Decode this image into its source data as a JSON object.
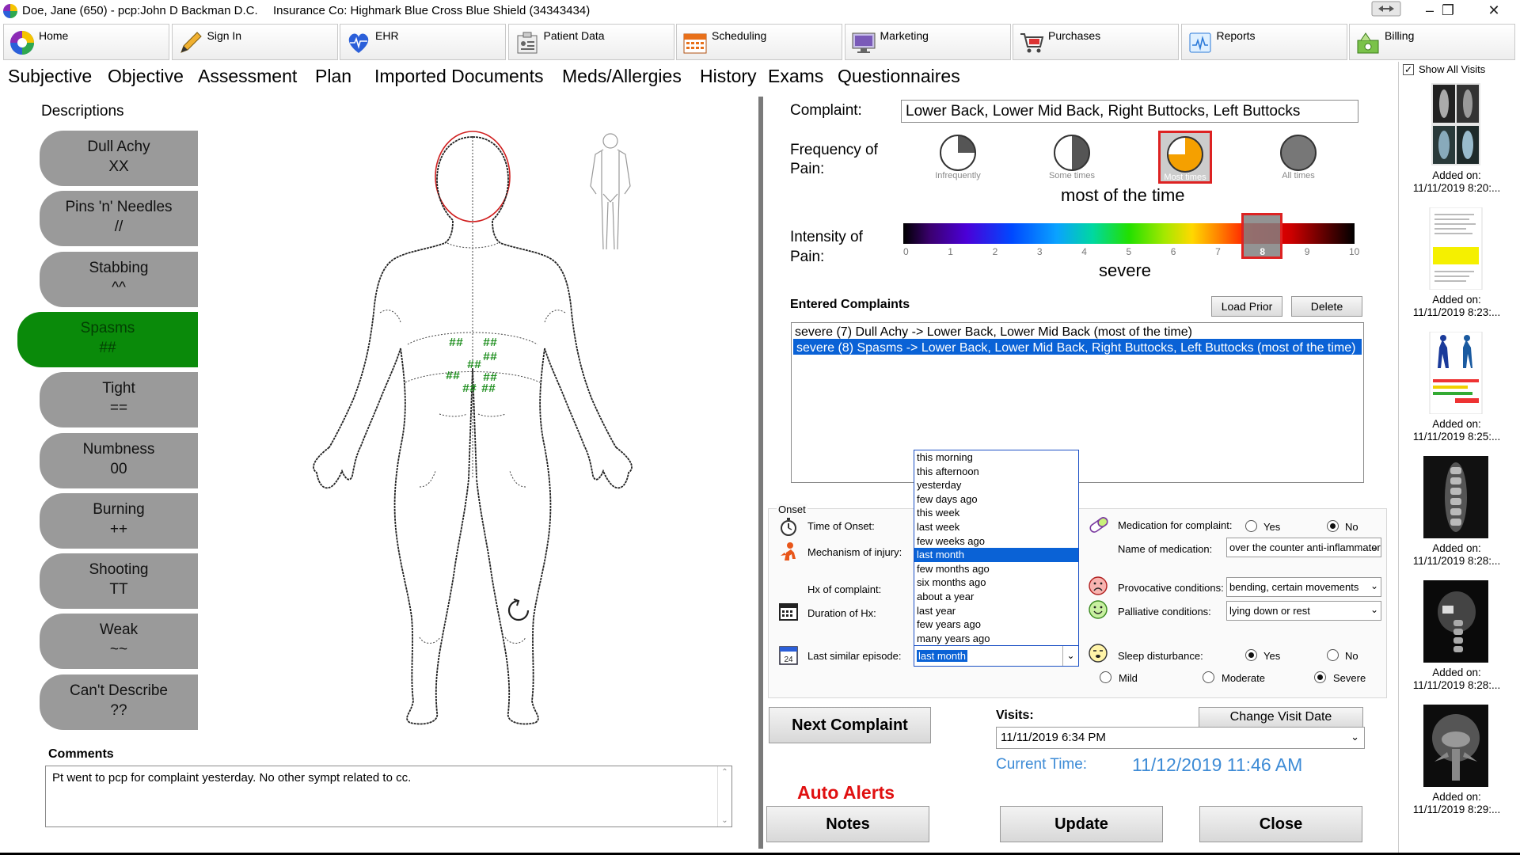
{
  "titlebar": {
    "patient": "Doe, Jane (650) - pcp:John D Backman D.C.",
    "insurance": "Insurance Co: Highmark Blue Cross Blue Shield (34343434)"
  },
  "toolbar": [
    {
      "label": "Home",
      "icon": "home-logo-icon"
    },
    {
      "label": "Sign In",
      "icon": "pencil-icon"
    },
    {
      "label": "EHR",
      "icon": "heart-icon"
    },
    {
      "label": "Patient Data",
      "icon": "patient-data-icon"
    },
    {
      "label": "Scheduling",
      "icon": "calendar-icon"
    },
    {
      "label": "Marketing",
      "icon": "monitor-icon"
    },
    {
      "label": "Purchases",
      "icon": "cart-icon"
    },
    {
      "label": "Reports",
      "icon": "report-icon"
    },
    {
      "label": "Billing",
      "icon": "billing-icon"
    }
  ],
  "tabs": [
    "Subjective",
    "Objective",
    "Assessment",
    "Plan",
    "Imported Documents",
    "Meds/Allergies",
    "History",
    "Exams",
    "Questionnaires"
  ],
  "active_tab": "Subjective",
  "descriptions_title": "Descriptions",
  "descriptions": [
    {
      "name": "Dull Achy",
      "symbol": "XX"
    },
    {
      "name": "Pins 'n' Needles",
      "symbol": "//"
    },
    {
      "name": "Stabbing",
      "symbol": "^^"
    },
    {
      "name": "Spasms",
      "symbol": "##"
    },
    {
      "name": "Tight",
      "symbol": "=="
    },
    {
      "name": "Numbness",
      "symbol": "00"
    },
    {
      "name": "Burning",
      "symbol": "++"
    },
    {
      "name": "Shooting",
      "symbol": "TT"
    },
    {
      "name": "Weak",
      "symbol": "~~"
    },
    {
      "name": "Can't Describe",
      "symbol": "??"
    }
  ],
  "active_description": "Spasms",
  "body_marks": "##",
  "comments": {
    "label": "Comments",
    "text": "Pt went to pcp for complaint yesterday.  No other sympt related to cc."
  },
  "complaint": {
    "label": "Complaint:",
    "value": "Lower Back, Lower Mid Back, Right Buttocks, Left Buttocks"
  },
  "frequency": {
    "label_1": "Frequency of",
    "label_2": "Pain:",
    "options": [
      "Infrequently",
      "Some times",
      "Most times",
      "All times"
    ],
    "selected": "Most times",
    "text": "most of the time"
  },
  "intensity": {
    "label_1": "Intensity of",
    "label_2": "Pain:",
    "ticks": [
      "0",
      "1",
      "2",
      "3",
      "4",
      "5",
      "6",
      "7",
      "8",
      "9",
      "10"
    ],
    "selected": 8,
    "text": "severe"
  },
  "entered": {
    "label": "Entered Complaints",
    "load_prior": "Load Prior",
    "delete": "Delete",
    "items": [
      "severe (7) Dull Achy -> Lower Back, Lower Mid Back (most of the time)",
      "severe (8) Spasms -> Lower Back, Lower Mid Back, Right Buttocks, Left Buttocks (most of the time)"
    ],
    "selected_index": 1
  },
  "onset": {
    "group_label": "Onset",
    "time_of_onset": "Time of Onset:",
    "mechanism": "Mechanism of injury:",
    "hx": "Hx of complaint:",
    "duration": "Duration of Hx:",
    "last_similar": "Last similar episode:",
    "last_similar_value": "last month",
    "dropdown_options": [
      "this morning",
      "this afternoon",
      "yesterday",
      "few days ago",
      "this week",
      "last week",
      "few weeks ago",
      "last month",
      "few months ago",
      "six months ago",
      "about a year",
      "last year",
      "few years ago",
      "many years ago"
    ],
    "dropdown_selected": "last month",
    "calendar_day": "24"
  },
  "medication": {
    "label": "Medication for complaint:",
    "yes": "Yes",
    "no": "No",
    "selected": "No",
    "name_label": "Name of medication:",
    "name_value": "over the counter anti-inflammatory"
  },
  "provocative": {
    "label": "Provocative conditions:",
    "value": "bending, certain movements"
  },
  "palliative": {
    "label": "Palliative conditions:",
    "value": "lying down or rest"
  },
  "sleep": {
    "label": "Sleep disturbance:",
    "yes": "Yes",
    "no": "No",
    "selected": "Yes",
    "mild": "Mild",
    "moderate": "Moderate",
    "severe": "Severe",
    "severity": "Severe"
  },
  "buttons": {
    "next_complaint": "Next Complaint",
    "notes": "Notes",
    "update": "Update",
    "close": "Close",
    "change_visit_date": "Change Visit Date"
  },
  "visits": {
    "label": "Visits:",
    "value": "11/11/2019 6:34 PM"
  },
  "current_time": {
    "label": "Current Time:",
    "value": "11/12/2019  11:46 AM"
  },
  "auto_alerts": "Auto Alerts",
  "thumbnails": {
    "show_all": "Show All Visits",
    "checked": true,
    "items": [
      {
        "caption": "Added on:",
        "date": "11/11/2019 8:20:..."
      },
      {
        "caption": "Added on:",
        "date": "11/11/2019 8:23:..."
      },
      {
        "caption": "Added on:",
        "date": "11/11/2019 8:25:..."
      },
      {
        "caption": "Added on:",
        "date": "11/11/2019 8:28:..."
      },
      {
        "caption": "Added on:",
        "date": "11/11/2019 8:28:..."
      },
      {
        "caption": "Added on:",
        "date": "11/11/2019 8:29:..."
      }
    ]
  },
  "colors": {
    "active_green": "#0a8a0a",
    "selection_blue": "#0a62d6",
    "alert_red": "#e01010",
    "time_blue": "#3d8bd6",
    "freq_orange": "#f5a000"
  }
}
